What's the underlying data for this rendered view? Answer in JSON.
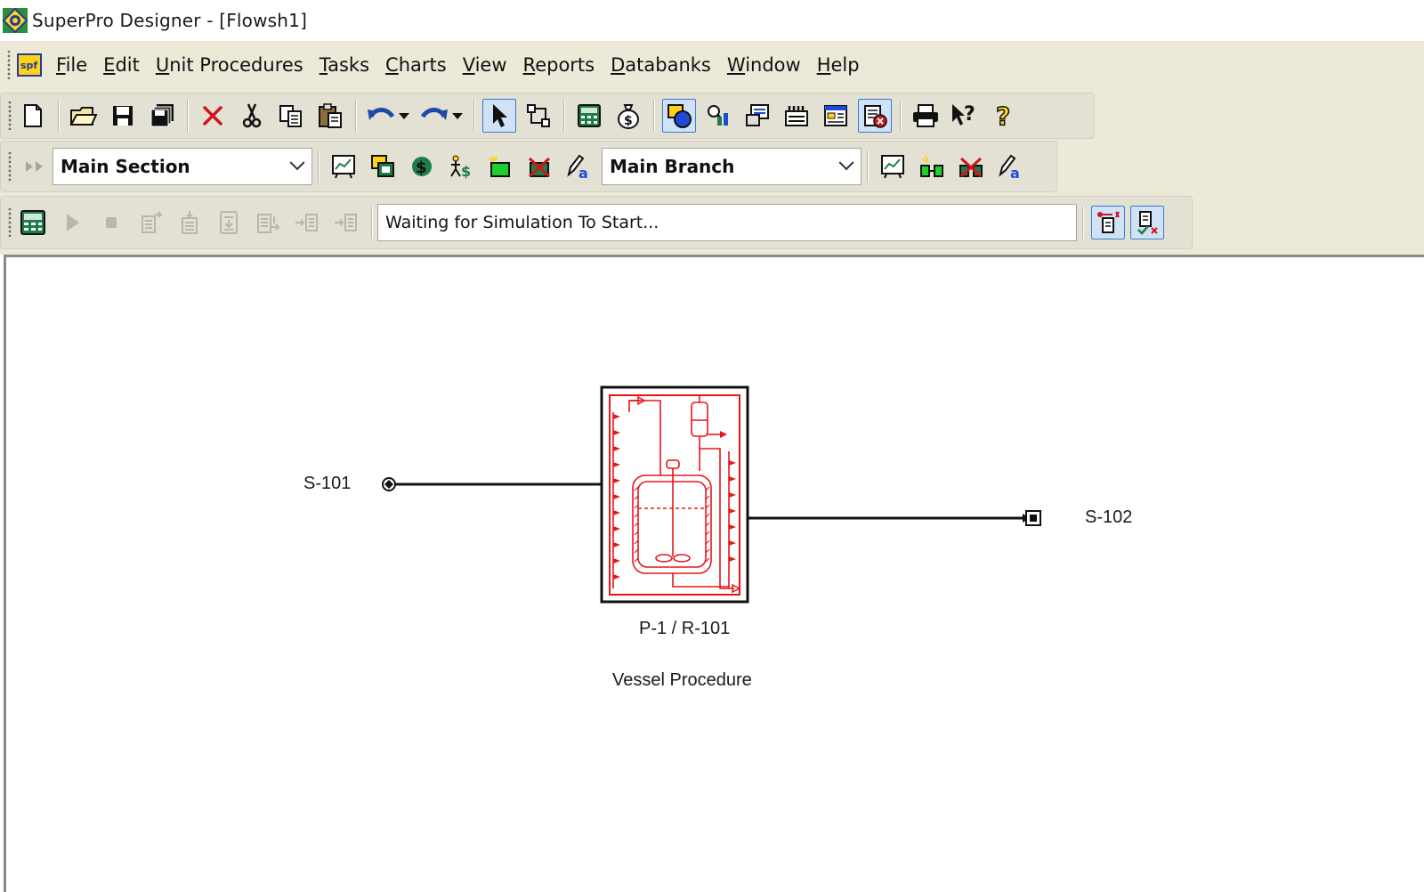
{
  "window": {
    "title": "SuperPro Designer - [Flowsh1]"
  },
  "menu": {
    "items": [
      {
        "label": "File",
        "accel": "F",
        "rest": "ile"
      },
      {
        "label": "Edit",
        "accel": "E",
        "rest": "dit"
      },
      {
        "label": "Unit Procedures",
        "accel": "U",
        "rest": "nit Procedures"
      },
      {
        "label": "Tasks",
        "accel": "T",
        "rest": "asks"
      },
      {
        "label": "Charts",
        "accel": "C",
        "rest": "harts"
      },
      {
        "label": "View",
        "accel": "V",
        "rest": "iew"
      },
      {
        "label": "Reports",
        "accel": "R",
        "rest": "eports"
      },
      {
        "label": "Databanks",
        "accel": "D",
        "rest": "atabanks"
      },
      {
        "label": "Window",
        "accel": "W",
        "rest": "indow"
      },
      {
        "label": "Help",
        "accel": "H",
        "rest": "elp"
      }
    ]
  },
  "toolbar2": {
    "section_combo": "Main Section",
    "branch_combo": "Main Branch"
  },
  "toolbar3": {
    "status_text": "Waiting for Simulation To Start..."
  },
  "flowsheet": {
    "input_stream": "S-101",
    "output_stream": "S-102",
    "unit_tag": "P-1 / R-101",
    "unit_description": "Vessel Procedure"
  },
  "colors": {
    "chrome": "#ece9d8",
    "equipment": "#e8141c",
    "active_button": "#cfe2f6"
  }
}
